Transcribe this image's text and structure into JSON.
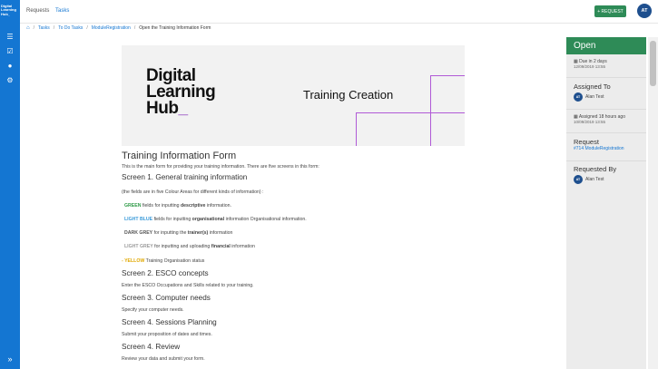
{
  "sidebar": {
    "logo_lines": [
      "Digital",
      "Learning",
      "Hub_"
    ],
    "items": [
      {
        "icon": "list-icon",
        "glyph": "☰"
      },
      {
        "icon": "check-square-icon",
        "glyph": "☑"
      },
      {
        "icon": "user-icon",
        "glyph": "●"
      },
      {
        "icon": "gear-icon",
        "glyph": "⚙"
      }
    ],
    "expand_glyph": "»"
  },
  "topbar": {
    "tabs": [
      "Requests",
      "Tasks"
    ],
    "request_button": "+ REQUEST",
    "user_initials": "AT"
  },
  "breadcrumb": {
    "home_glyph": "⌂",
    "items": [
      "Tasks",
      "To Do Tasks",
      "ModuleRegistration",
      "Open the Training Information Form"
    ]
  },
  "banner": {
    "logo_line1": "Digital",
    "logo_line2": "Learning",
    "logo_line3": "Hub",
    "logo_underscore": "_",
    "title": "Training Creation"
  },
  "form": {
    "title": "Training Information Form",
    "intro": "This is the main form for providing your training information. There are five screens in this form:",
    "screen1": {
      "heading": "Screen 1. General training information",
      "note": "(the fields are in five Colour Areas for different kinds of information) :",
      "green": {
        "label": "GREEN",
        "before": " fields for inputting ",
        "bold": "descriptive",
        "after": " information."
      },
      "lightblue": {
        "label": "LIGHT BLUE",
        "before": " fields for inputting ",
        "bold": "organisational",
        "after": " information Organisational information."
      },
      "darkgrey": {
        "label": "DARK GREY",
        "before": " for inputting the ",
        "bold": "trainer(s)",
        "after": " information"
      },
      "lightgrey": {
        "label": "LIGHT GREY",
        "before": " for inputting and uploading ",
        "bold": "financial",
        "after": " information"
      },
      "yellow": {
        "label": "- YELLOW",
        "after": " Training Organisation status"
      }
    },
    "screen2": {
      "heading": "Screen 2. ESCO concepts",
      "text": "Enter the ESCO Occupations and Skills related to your training."
    },
    "screen3": {
      "heading": "Screen 3. Computer needs",
      "text": "Specify your computer needs."
    },
    "screen4": {
      "heading": "Screen 4. Sessions Planning",
      "text": "Submit your proposition of dates and times."
    },
    "screen5": {
      "heading": "Screen 4. Review",
      "text": "Review your data and submit your form."
    }
  },
  "right_panel": {
    "status": "Open",
    "due": {
      "label": "Due in 2 days",
      "date": "12/09/2019 13:55"
    },
    "assigned_to": {
      "title": "Assigned To",
      "initials": "AT",
      "name": "Alan Test"
    },
    "assigned_ago": {
      "label": "Assigned 18 hours ago",
      "date": "10/09/2019 13:55"
    },
    "request": {
      "title": "Request",
      "link": "#714 ModuleRegistration"
    },
    "requested_by": {
      "title": "Requested By",
      "initials": "AT",
      "name": "Alan Test"
    }
  },
  "colors": {
    "sidebar_blue": "#1476d2",
    "status_green": "#2e8b57",
    "brand_purple": "#8e3fbf"
  }
}
